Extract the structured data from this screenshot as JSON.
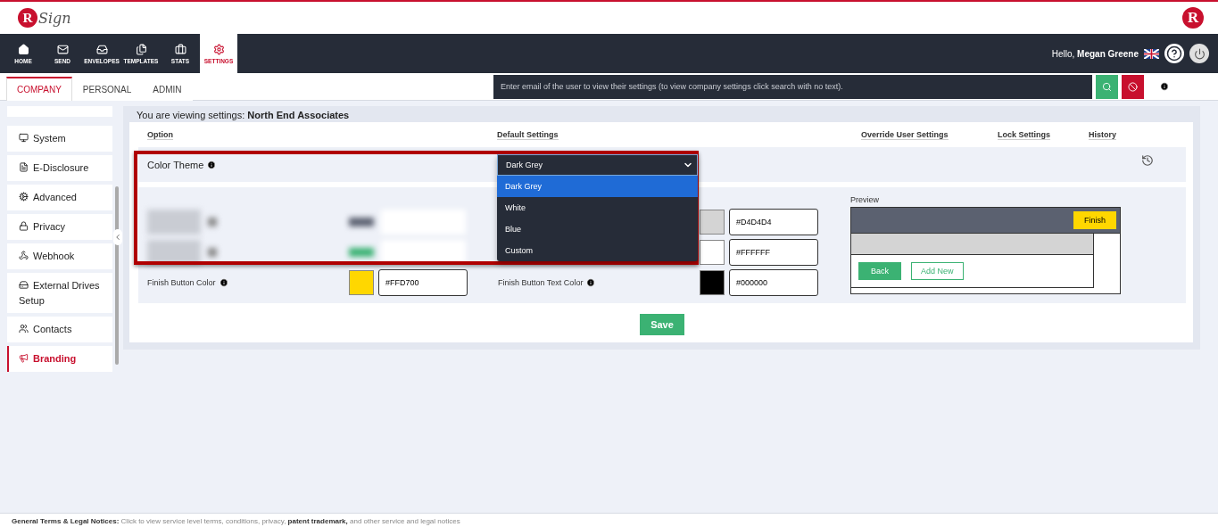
{
  "header": {
    "logo_letter": "R",
    "logo_word": "Sign",
    "corner_letter": "R"
  },
  "nav": {
    "items": [
      {
        "label": "HOME",
        "selected": false
      },
      {
        "label": "SEND",
        "selected": false
      },
      {
        "label": "ENVELOPES",
        "selected": false
      },
      {
        "label": "TEMPLATES",
        "selected": false
      },
      {
        "label": "STATS",
        "selected": false
      },
      {
        "label": "SETTINGS",
        "selected": true
      }
    ],
    "greeting": "Hello,",
    "user": "Megan Greene"
  },
  "tabs": [
    {
      "label": "COMPANY",
      "selected": true
    },
    {
      "label": "PERSONAL",
      "selected": false
    },
    {
      "label": "ADMIN",
      "selected": false
    }
  ],
  "search": {
    "placeholder": "Enter email of the user to view their settings (to view company settings click search with no text)."
  },
  "sidebar": {
    "items": [
      {
        "label": "System",
        "selected": false
      },
      {
        "label": "E-Disclosure",
        "selected": false
      },
      {
        "label": "Advanced",
        "selected": false
      },
      {
        "label": "Privacy",
        "selected": false
      },
      {
        "label": "Webhook",
        "selected": false
      },
      {
        "label": "External Drives Setup",
        "selected": false
      },
      {
        "label": "Contacts",
        "selected": false
      },
      {
        "label": "Branding",
        "selected": true
      }
    ]
  },
  "main": {
    "viewing_label": "You are viewing settings:",
    "company": "North End Associates",
    "columns": [
      "Option",
      "Default Settings",
      "Override User Settings",
      "Lock Settings",
      "History"
    ],
    "color_theme": {
      "label": "Color Theme",
      "value": "Dark Grey",
      "expanded": true,
      "options": [
        {
          "label": "Dark Grey",
          "selected": true
        },
        {
          "label": "White",
          "selected": false
        },
        {
          "label": "Blue",
          "selected": false
        },
        {
          "label": "Custom",
          "selected": false
        }
      ]
    },
    "left_fields": [
      {
        "kind": "blurred"
      },
      {
        "kind": "blurred"
      },
      {
        "kind": "field",
        "label": "Finish Button Color",
        "value": "#FFD700"
      }
    ],
    "right_fields": [
      {
        "kind": "field",
        "value": "#D4D4D4"
      },
      {
        "kind": "field",
        "value": "#FFFFFF"
      },
      {
        "kind": "field",
        "label": "Finish Button Text Color",
        "value": "#000000"
      }
    ],
    "preview": {
      "title": "Preview",
      "finish": "Finish",
      "back": "Back",
      "add_new": "Add New"
    },
    "save": "Save"
  },
  "footer": {
    "title": "General Terms & Legal Notices:",
    "text": "Click to view service level terms, conditions, privacy,",
    "patent": "patent",
    "trademark": "trademark,",
    "rest": "and other service and legal notices"
  }
}
